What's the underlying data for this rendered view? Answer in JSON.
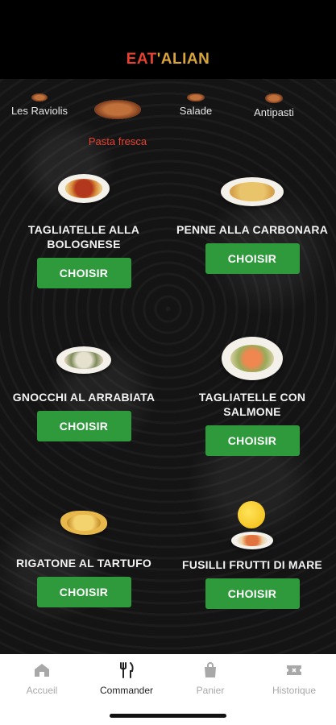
{
  "header": {
    "brand_part1": "EAT",
    "brand_part2": "'ALIAN"
  },
  "categories": [
    {
      "label": "Les Raviolis",
      "active": false
    },
    {
      "label": "Pasta fresca",
      "active": true
    },
    {
      "label": "Salade",
      "active": false
    },
    {
      "label": "Antipasti",
      "active": false
    }
  ],
  "dishes": [
    {
      "name": "TAGLIATELLE ALLA BOLOGNESE",
      "button": "CHOISIR"
    },
    {
      "name": "PENNE ALLA CARBONARA",
      "button": "CHOISIR"
    },
    {
      "name": "GNOCCHI AL ARRABIATA",
      "button": "CHOISIR"
    },
    {
      "name": "TAGLIATELLE CON SALMONE",
      "button": "CHOISIR"
    },
    {
      "name": "RIGATONE AL TARTUFO",
      "button": "CHOISIR"
    },
    {
      "name": "FUSILLI FRUTTI DI MARE",
      "button": "CHOISIR"
    }
  ],
  "bottom_nav": [
    {
      "label": "Accueil",
      "icon": "home-icon",
      "active": false
    },
    {
      "label": "Commander",
      "icon": "cutlery-icon",
      "active": true
    },
    {
      "label": "Panier",
      "icon": "bag-icon",
      "active": false
    },
    {
      "label": "Historique",
      "icon": "ticket-icon",
      "active": false
    }
  ],
  "colors": {
    "brand_red": "#e8412f",
    "brand_gold": "#d9a53a",
    "button_green": "#2f9a3c",
    "active_category": "#e8412f"
  }
}
